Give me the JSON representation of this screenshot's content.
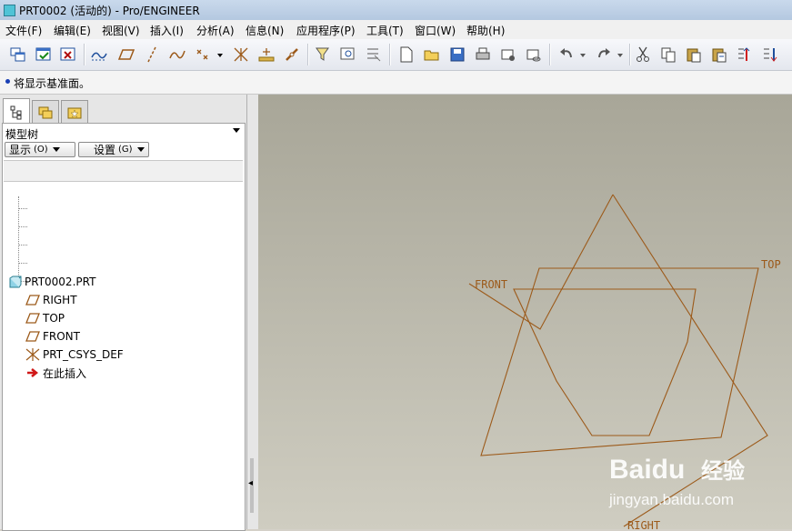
{
  "window": {
    "title": "PRT0002 (活动的) - Pro/ENGINEER",
    "icon": "app-cube-icon"
  },
  "menu": [
    "文件(F)",
    "编辑(E)",
    "视图(V)",
    "插入(I)",
    "分析(A)",
    "信息(N)",
    "应用程序(P)",
    "工具(T)",
    "窗口(W)",
    "帮助(H)"
  ],
  "toolbar": {
    "icons": [
      "new-window-icon",
      "activate-window-icon",
      "close-window-icon",
      "datum-curve-display-icon",
      "datum-plane-display-icon",
      "datum-axis-display-icon",
      "sketched-curve-icon",
      "datum-point-icon",
      "coordinate-system-icon",
      "spin-center-icon",
      "link-icon",
      "select-filter-icon",
      "repaint-icon",
      "saved-view-icon",
      "new-file-icon",
      "open-file-icon",
      "save-icon",
      "print-icon",
      "send-mail-icon",
      "send-mail-attach-icon",
      "undo-icon",
      "redo-icon",
      "cut-icon",
      "copy-icon",
      "paste-icon",
      "paste-special-icon",
      "regenerate-icon",
      "regen-manager-icon"
    ]
  },
  "message": "将显示基准面。",
  "left_panel": {
    "tabs": [
      "model-tree-tab",
      "folder-browser-tab",
      "favorites-tab"
    ],
    "header": "模型树",
    "show_button": {
      "label": "显示",
      "hotkey": "(O)"
    },
    "settings_button": {
      "label": "设置",
      "hotkey": "(G)"
    },
    "tree": [
      {
        "label": "PRT0002.PRT",
        "icon": "part-icon"
      },
      {
        "label": "RIGHT",
        "icon": "datum-plane-icon"
      },
      {
        "label": "TOP",
        "icon": "datum-plane-icon"
      },
      {
        "label": "FRONT",
        "icon": "datum-plane-icon"
      },
      {
        "label": "PRT_CSYS_DEF",
        "icon": "csys-icon"
      },
      {
        "label": "在此插入",
        "icon": "insert-here-arrow-icon"
      }
    ]
  },
  "viewport": {
    "planes": [
      {
        "name": "FRONT"
      },
      {
        "name": "TOP"
      },
      {
        "name": "RIGHT"
      }
    ],
    "datum_color": "#9c5a1a",
    "background_top": "#a8a698",
    "background_bottom": "#cfcdc1"
  },
  "watermark": {
    "brand": "Baidu",
    "brand_cn": "经验",
    "url": "jingyan.baidu.com"
  }
}
